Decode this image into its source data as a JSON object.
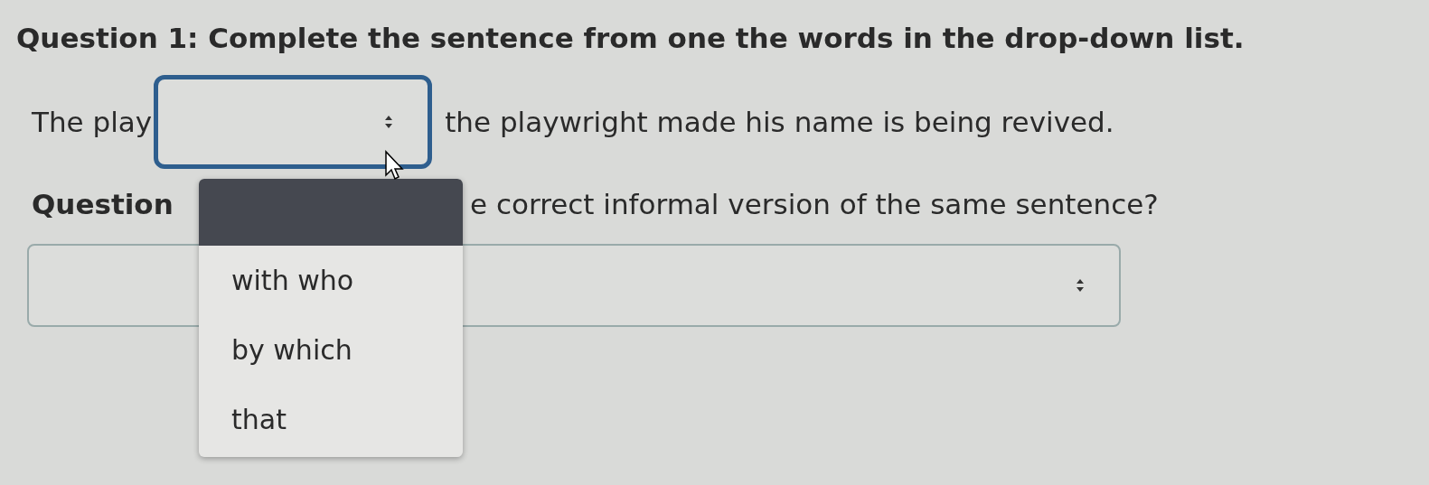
{
  "question_1": {
    "title": "Question 1: Complete the sentence from one the words in the drop-down list.",
    "before": "The play",
    "after": "the playwright made his name is being revived.",
    "select": {
      "focused": true,
      "open": true,
      "options": [
        {
          "label": "with who",
          "selected": false
        },
        {
          "label": "by which",
          "selected": false
        },
        {
          "label": "that",
          "selected": false
        }
      ]
    }
  },
  "question_2": {
    "title_start": "Question",
    "title_end": "e correct informal version of the same sentence?",
    "select": {
      "focused": false
    }
  }
}
